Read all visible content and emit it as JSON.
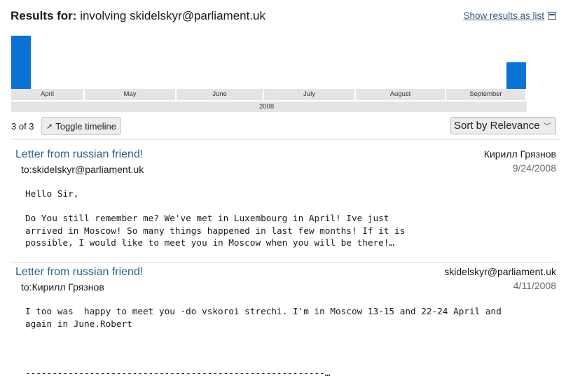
{
  "header": {
    "label": "Results for:",
    "query": "involving skidelskyr@parliament.uk",
    "show_list_label": "Show results as list",
    "show_list_icon": "list-view-icon"
  },
  "timeline": {
    "year": "2008",
    "months": [
      "April",
      "May",
      "June",
      "July",
      "August",
      "September"
    ],
    "counts": [
      2,
      0,
      0,
      0,
      0,
      1
    ],
    "bar_color": "#0a73d6"
  },
  "toolbar": {
    "count": "3 of 3",
    "toggle_label": "Toggle timeline",
    "toggle_icon": "trend-arrow-icon",
    "sort_label": "Sort by Relevance",
    "sort_icon": "chevron-down-icon"
  },
  "results": [
    {
      "subject": "Letter from russian friend!",
      "to": "to:skidelskyr@parliament.uk",
      "from": "Кирилл Грязнов",
      "date": "9/24/2008",
      "body": "Hello Sir,\n\nDo You still remember me? We've met in Luxembourg in April! Ive just\narrived in Moscow! So many things happened in last few months! If it is\npossible, I would like to meet you in Moscow when you will be there!…"
    },
    {
      "subject": "Letter from russian friend!",
      "to": "to:Кирилл Грязнов",
      "from": "skidelskyr@parliament.uk",
      "date": "4/11/2008",
      "body": "I too was  happy to meet you -do vskoroi strechi. I'm in Moscow 13-15 and 22-24 April and\nagain in June.Robert\n\n\n\n--------------------------------------------------------…"
    }
  ],
  "colors": {
    "link": "#2e5f86",
    "accent": "#0a73d6"
  }
}
